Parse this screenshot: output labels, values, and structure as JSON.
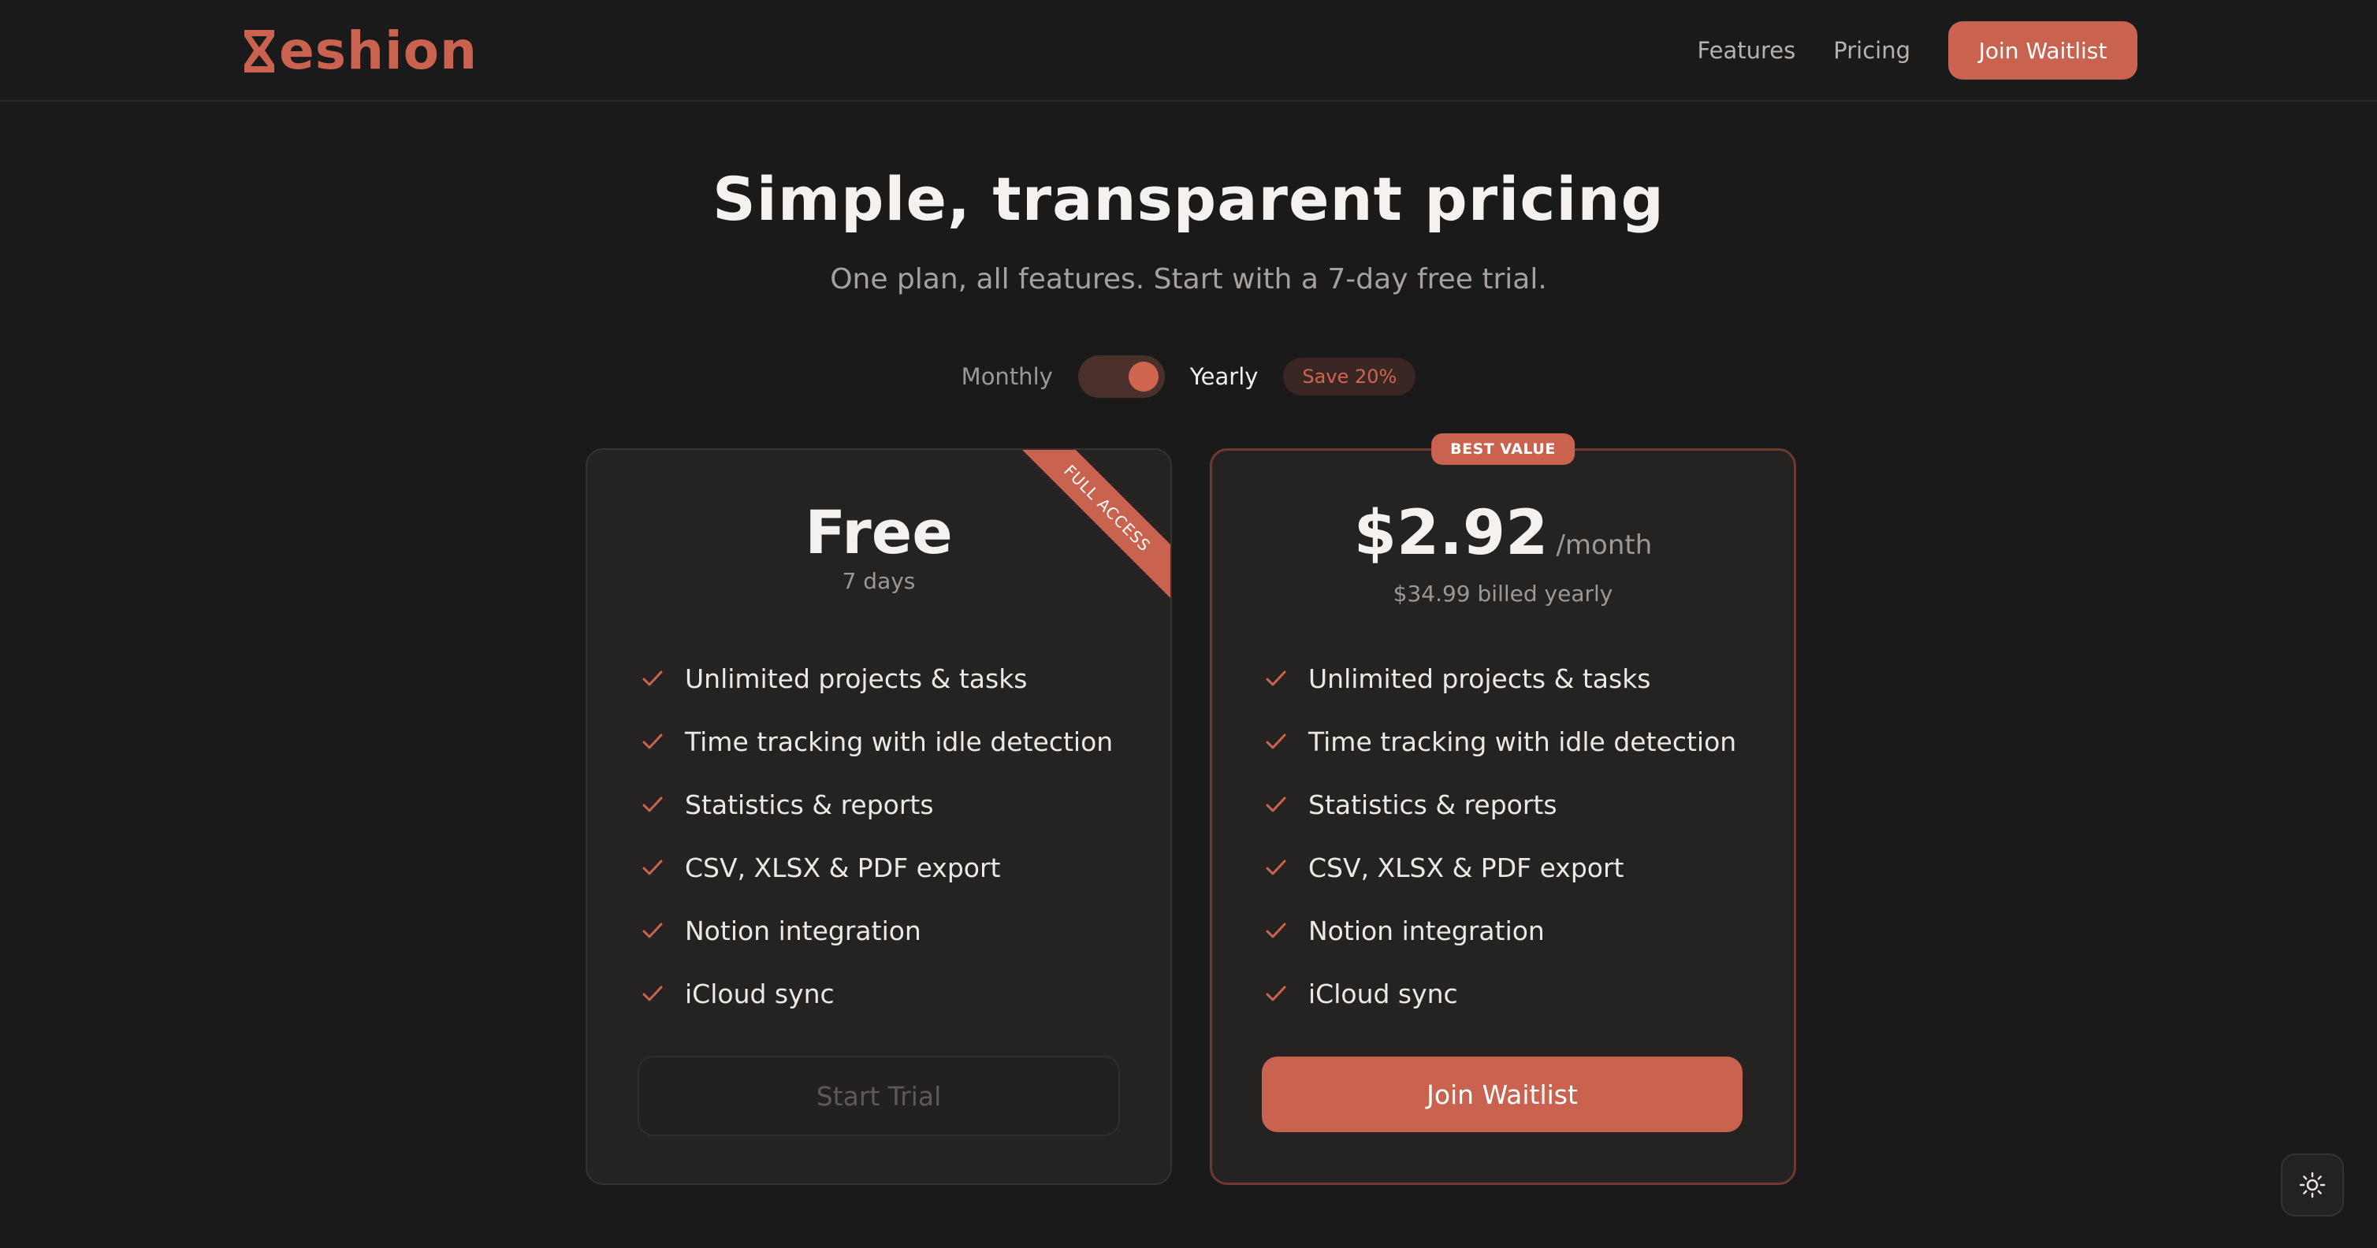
{
  "brand": {
    "name": "eshion",
    "accent_color": "#c9634f"
  },
  "nav": {
    "links": [
      "Features",
      "Pricing"
    ],
    "cta": "Join Waitlist"
  },
  "hero": {
    "title": "Simple, transparent pricing",
    "subtitle": "One plan, all features. Start with a 7-day free trial."
  },
  "billing": {
    "monthly": "Monthly",
    "yearly": "Yearly",
    "selected": "Yearly",
    "save_badge": "Save 20%"
  },
  "plans": {
    "free": {
      "ribbon": "FULL ACCESS",
      "name": "Free",
      "duration": "7 days",
      "features": [
        "Unlimited projects & tasks",
        "Time tracking with idle detection",
        "Statistics & reports",
        "CSV, XLSX & PDF export",
        "Notion integration",
        "iCloud sync"
      ],
      "button": "Start Trial"
    },
    "pro": {
      "badge": "BEST VALUE",
      "price": "$2.92",
      "period": "/month",
      "billed": "$34.99 billed yearly",
      "features": [
        "Unlimited projects & tasks",
        "Time tracking with idle detection",
        "Statistics & reports",
        "CSV, XLSX & PDF export",
        "Notion integration",
        "iCloud sync"
      ],
      "button": "Join Waitlist"
    }
  },
  "icons": {
    "feature": "check-icon",
    "theme": "sun-icon"
  }
}
